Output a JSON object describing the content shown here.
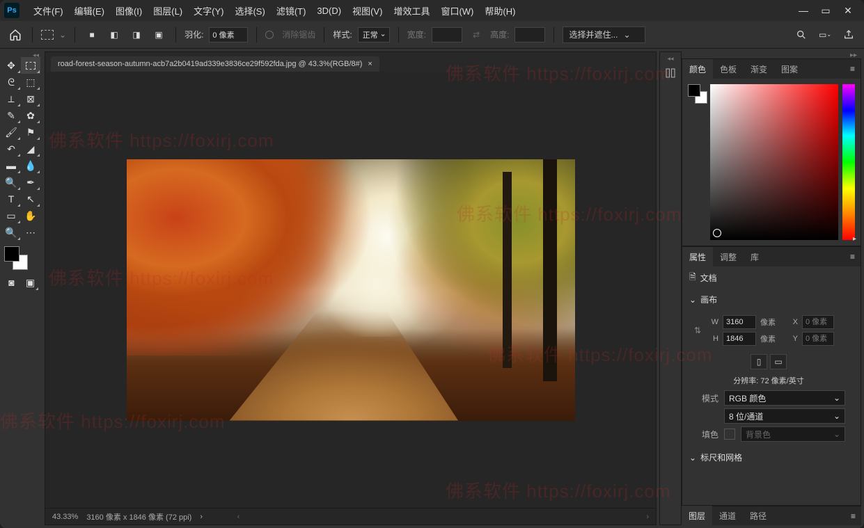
{
  "app": {
    "logo": "Ps"
  },
  "menu": [
    "文件(F)",
    "编辑(E)",
    "图像(I)",
    "图层(L)",
    "文字(Y)",
    "选择(S)",
    "滤镜(T)",
    "3D(D)",
    "视图(V)",
    "增效工具",
    "窗口(W)",
    "帮助(H)"
  ],
  "options": {
    "feather_label": "羽化:",
    "feather_value": "0 像素",
    "antialias": "消除锯齿",
    "style_label": "样式:",
    "style_value": "正常",
    "width_label": "宽度:",
    "height_label": "高度:",
    "select_mask": "选择并遮住..."
  },
  "doc": {
    "tab": "road-forest-season-autumn-acb7a2b0419ad339e3836ce29f592fda.jpg @ 43.3%(RGB/8#)",
    "zoom": "43.33%",
    "dims": "3160 像素 x 1846 像素 (72 ppi)"
  },
  "panels": {
    "color_tabs": [
      "颜色",
      "色板",
      "渐变",
      "图案"
    ],
    "prop_tabs": [
      "属性",
      "调整",
      "库"
    ],
    "doc_label": "文档",
    "canvas": "画布",
    "w_label": "W",
    "w_val": "3160",
    "unit": "像素",
    "h_label": "H",
    "h_val": "1846",
    "x_label": "X",
    "x_ph": "0 像素",
    "y_label": "Y",
    "y_ph": "0 像素",
    "res_text": "分辨率: 72 像素/英寸",
    "mode_label": "模式",
    "mode_val": "RGB 颜色",
    "depth_val": "8 位/通道",
    "fill_label": "填色",
    "fill_val": "背景色",
    "rulers": "标尺和网格",
    "bottom_tabs": [
      "图层",
      "通道",
      "路径"
    ]
  },
  "watermark": "佛系软件 https://foxirj.com"
}
